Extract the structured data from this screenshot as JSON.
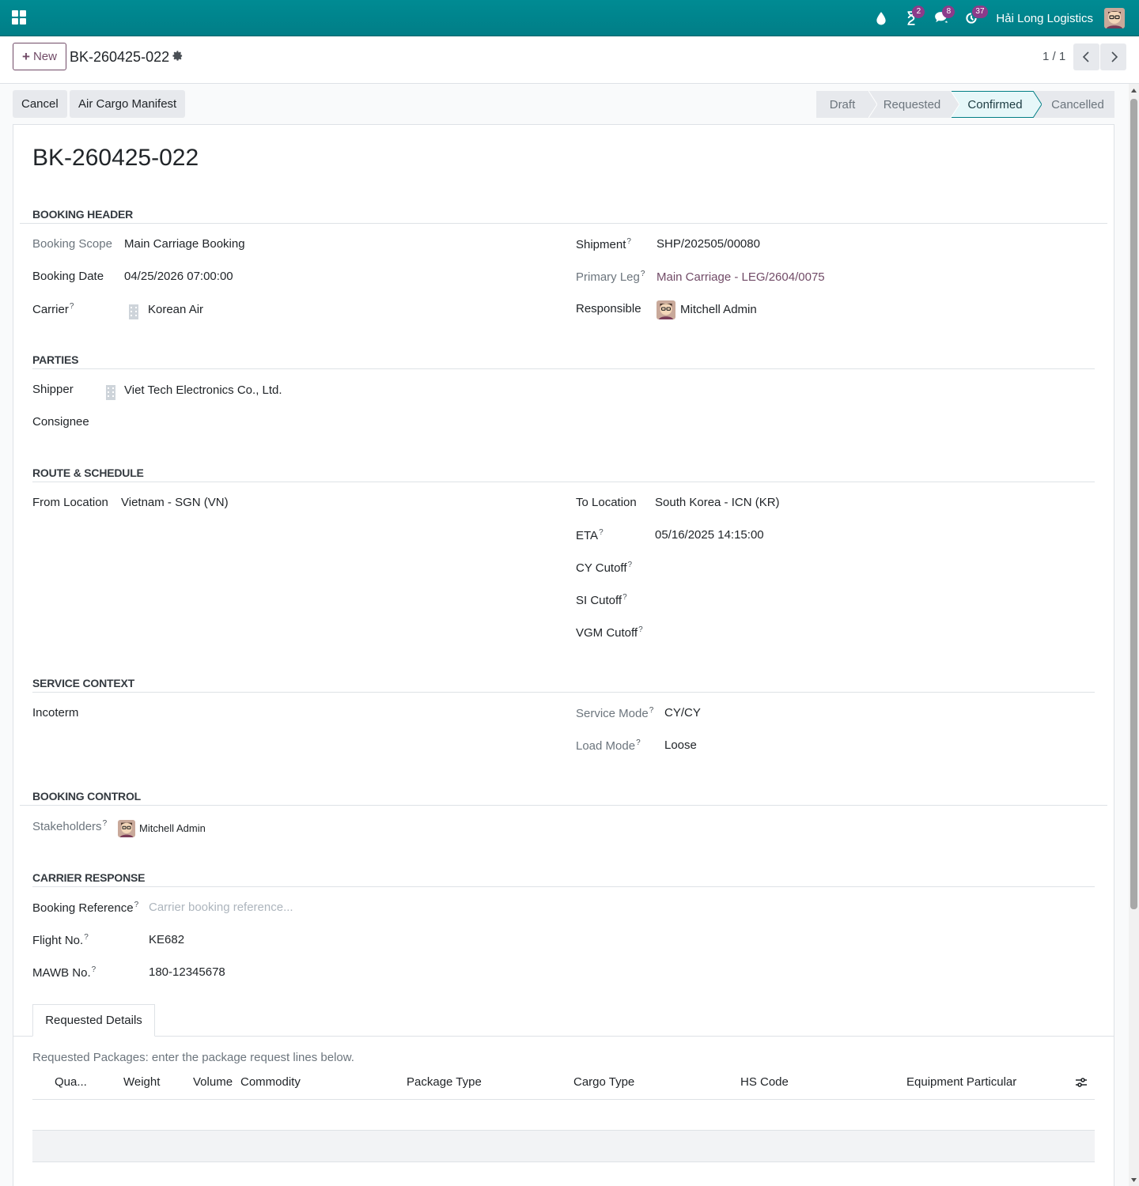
{
  "navbar": {
    "apps_icon": "grid-icon",
    "company": "Hải Long Logistics",
    "icons": [
      {
        "name": "drop-icon",
        "badge": ""
      },
      {
        "name": "hourglass-icon",
        "badge": "2"
      },
      {
        "name": "chat-icon",
        "badge": "8"
      },
      {
        "name": "activity-icon",
        "badge": "37"
      }
    ]
  },
  "control": {
    "new_label": "New",
    "breadcrumb": "BK-260425-022",
    "pager": "1 / 1"
  },
  "actions": {
    "cancel": "Cancel",
    "manifest": "Air Cargo Manifest"
  },
  "status": {
    "steps": [
      "Draft",
      "Requested",
      "Confirmed",
      "Cancelled"
    ],
    "active": "Confirmed"
  },
  "record": {
    "title": "BK-260425-022"
  },
  "booking_header": {
    "title": "BOOKING HEADER",
    "scope_label": "Booking Scope",
    "scope_value": "Main Carriage Booking",
    "date_label": "Booking Date",
    "date_value": "04/25/2026 07:00:00",
    "carrier_label": "Carrier",
    "carrier_value": "Korean Air",
    "shipment_label": "Shipment",
    "shipment_value": "SHP/202505/00080",
    "leg_label": "Primary Leg",
    "leg_value": "Main Carriage - LEG/2604/0075",
    "responsible_label": "Responsible",
    "responsible_value": "Mitchell Admin"
  },
  "parties": {
    "title": "PARTIES",
    "shipper_label": "Shipper",
    "shipper_value": "Viet Tech Electronics Co., Ltd.",
    "consignee_label": "Consignee"
  },
  "route": {
    "title": "ROUTE & SCHEDULE",
    "from_label": "From Location",
    "from_value": "Vietnam - SGN (VN)",
    "to_label": "To Location",
    "to_value": "South Korea - ICN (KR)",
    "eta_label": "ETA",
    "eta_value": "05/16/2025 14:15:00",
    "cy_label": "CY Cutoff",
    "si_label": "SI Cutoff",
    "vgm_label": "VGM Cutoff"
  },
  "service": {
    "title": "SERVICE CONTEXT",
    "incoterm_label": "Incoterm",
    "mode_label": "Service Mode",
    "mode_value": "CY/CY",
    "load_label": "Load Mode",
    "load_value": "Loose"
  },
  "control_section": {
    "title": "BOOKING CONTROL",
    "stakeholders_label": "Stakeholders",
    "stakeholder": "Mitchell Admin"
  },
  "carrier_response": {
    "title": "CARRIER RESPONSE",
    "ref_label": "Booking Reference",
    "ref_placeholder": "Carrier booking reference...",
    "flight_label": "Flight No.",
    "flight_value": "KE682",
    "mawb_label": "MAWB No.",
    "mawb_value": "180-12345678"
  },
  "notebook": {
    "tab": "Requested Details",
    "help": "Requested Packages: enter the package request lines below.",
    "columns": [
      "Qua...",
      "Weight",
      "Volume",
      "Commodity",
      "Package Type",
      "Cargo Type",
      "HS Code",
      "Equipment Particular"
    ]
  },
  "colors": {
    "navbar": "#017e87",
    "brand": "#714b67",
    "active_step": "#e6f7f9"
  }
}
